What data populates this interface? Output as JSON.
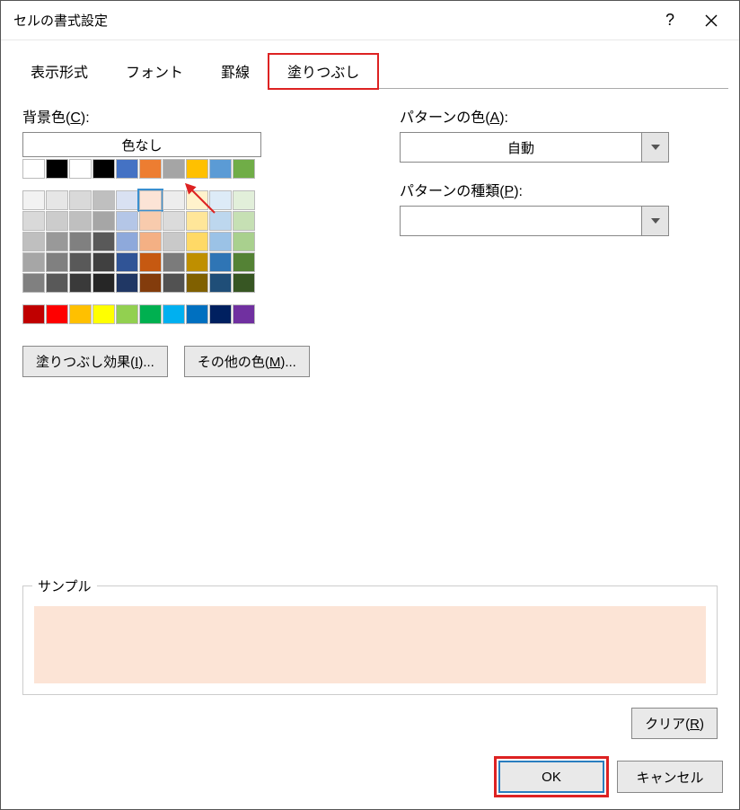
{
  "window": {
    "title": "セルの書式設定"
  },
  "tabs": [
    {
      "label": "表示形式",
      "active": false
    },
    {
      "label": "フォント",
      "active": false
    },
    {
      "label": "罫線",
      "active": false
    },
    {
      "label": "塗りつぶし",
      "active": true,
      "highlight": true
    }
  ],
  "left": {
    "bgcolor_label_pre": "背景色(",
    "bgcolor_label_key": "C",
    "bgcolor_label_post": "):",
    "no_color": "色なし",
    "rows": [
      [
        "#ffffff",
        "#000000",
        "#ffffff",
        "#000000",
        "#4472c4",
        "#ed7d31",
        "#a5a5a5",
        "#ffc000",
        "#5b9bd5",
        "#70ad47"
      ],
      [
        "#f2f2f2",
        "#e6e6e6",
        "#d9d9d9",
        "#bfbfbf",
        "#d9e1f2",
        "#fce4d6",
        "#ededed",
        "#fff2cc",
        "#ddebf7",
        "#e2efda"
      ],
      [
        "#d9d9d9",
        "#cccccc",
        "#bfbfbf",
        "#a6a6a6",
        "#b4c6e7",
        "#f8cbad",
        "#dbdbdb",
        "#ffe699",
        "#bdd7ee",
        "#c6e0b4"
      ],
      [
        "#bfbfbf",
        "#999999",
        "#808080",
        "#595959",
        "#8ea9db",
        "#f4b084",
        "#c9c9c9",
        "#ffd966",
        "#9bc2e6",
        "#a9d08e"
      ],
      [
        "#a6a6a6",
        "#808080",
        "#595959",
        "#404040",
        "#305496",
        "#c65911",
        "#7b7b7b",
        "#bf8f00",
        "#2f75b5",
        "#548235"
      ],
      [
        "#808080",
        "#595959",
        "#3a3a3a",
        "#262626",
        "#203764",
        "#833c0c",
        "#525252",
        "#806000",
        "#1f4e78",
        "#375623"
      ],
      [
        "#c00000",
        "#ff0000",
        "#ffc000",
        "#ffff00",
        "#92d050",
        "#00b050",
        "#00b0f0",
        "#0070c0",
        "#002060",
        "#7030a0"
      ]
    ],
    "selected_row": 1,
    "selected_col": 5,
    "fill_effects_label": "塗りつぶし効果(",
    "fill_effects_key": "I",
    "fill_effects_post": ")...",
    "more_colors_label": "その他の色(",
    "more_colors_key": "M",
    "more_colors_post": ")..."
  },
  "right": {
    "pattern_color_pre": "パターンの色(",
    "pattern_color_key": "A",
    "pattern_color_post": "):",
    "pattern_color_value": "自動",
    "pattern_type_pre": "パターンの種類(",
    "pattern_type_key": "P",
    "pattern_type_post": "):",
    "pattern_type_value": ""
  },
  "sample": {
    "legend": "サンプル",
    "color": "#fce4d6"
  },
  "clear_pre": "クリア(",
  "clear_key": "R",
  "clear_post": ")",
  "footer": {
    "ok": "OK",
    "cancel": "キャンセル"
  }
}
